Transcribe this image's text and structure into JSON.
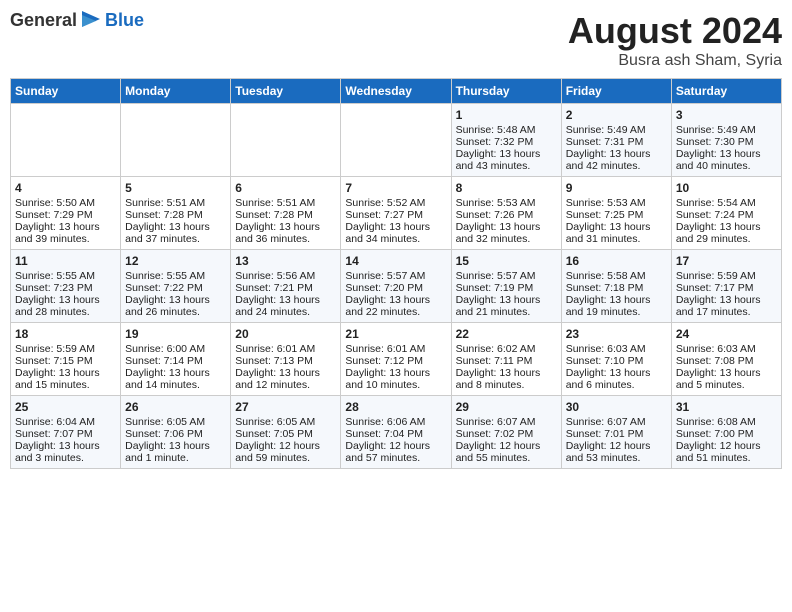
{
  "header": {
    "logo_general": "General",
    "logo_blue": "Blue",
    "title": "August 2024",
    "subtitle": "Busra ash Sham, Syria"
  },
  "calendar": {
    "columns": [
      "Sunday",
      "Monday",
      "Tuesday",
      "Wednesday",
      "Thursday",
      "Friday",
      "Saturday"
    ],
    "weeks": [
      [
        {
          "day": "",
          "content": ""
        },
        {
          "day": "",
          "content": ""
        },
        {
          "day": "",
          "content": ""
        },
        {
          "day": "",
          "content": ""
        },
        {
          "day": "1",
          "content": "Sunrise: 5:48 AM\nSunset: 7:32 PM\nDaylight: 13 hours\nand 43 minutes."
        },
        {
          "day": "2",
          "content": "Sunrise: 5:49 AM\nSunset: 7:31 PM\nDaylight: 13 hours\nand 42 minutes."
        },
        {
          "day": "3",
          "content": "Sunrise: 5:49 AM\nSunset: 7:30 PM\nDaylight: 13 hours\nand 40 minutes."
        }
      ],
      [
        {
          "day": "4",
          "content": "Sunrise: 5:50 AM\nSunset: 7:29 PM\nDaylight: 13 hours\nand 39 minutes."
        },
        {
          "day": "5",
          "content": "Sunrise: 5:51 AM\nSunset: 7:28 PM\nDaylight: 13 hours\nand 37 minutes."
        },
        {
          "day": "6",
          "content": "Sunrise: 5:51 AM\nSunset: 7:28 PM\nDaylight: 13 hours\nand 36 minutes."
        },
        {
          "day": "7",
          "content": "Sunrise: 5:52 AM\nSunset: 7:27 PM\nDaylight: 13 hours\nand 34 minutes."
        },
        {
          "day": "8",
          "content": "Sunrise: 5:53 AM\nSunset: 7:26 PM\nDaylight: 13 hours\nand 32 minutes."
        },
        {
          "day": "9",
          "content": "Sunrise: 5:53 AM\nSunset: 7:25 PM\nDaylight: 13 hours\nand 31 minutes."
        },
        {
          "day": "10",
          "content": "Sunrise: 5:54 AM\nSunset: 7:24 PM\nDaylight: 13 hours\nand 29 minutes."
        }
      ],
      [
        {
          "day": "11",
          "content": "Sunrise: 5:55 AM\nSunset: 7:23 PM\nDaylight: 13 hours\nand 28 minutes."
        },
        {
          "day": "12",
          "content": "Sunrise: 5:55 AM\nSunset: 7:22 PM\nDaylight: 13 hours\nand 26 minutes."
        },
        {
          "day": "13",
          "content": "Sunrise: 5:56 AM\nSunset: 7:21 PM\nDaylight: 13 hours\nand 24 minutes."
        },
        {
          "day": "14",
          "content": "Sunrise: 5:57 AM\nSunset: 7:20 PM\nDaylight: 13 hours\nand 22 minutes."
        },
        {
          "day": "15",
          "content": "Sunrise: 5:57 AM\nSunset: 7:19 PM\nDaylight: 13 hours\nand 21 minutes."
        },
        {
          "day": "16",
          "content": "Sunrise: 5:58 AM\nSunset: 7:18 PM\nDaylight: 13 hours\nand 19 minutes."
        },
        {
          "day": "17",
          "content": "Sunrise: 5:59 AM\nSunset: 7:17 PM\nDaylight: 13 hours\nand 17 minutes."
        }
      ],
      [
        {
          "day": "18",
          "content": "Sunrise: 5:59 AM\nSunset: 7:15 PM\nDaylight: 13 hours\nand 15 minutes."
        },
        {
          "day": "19",
          "content": "Sunrise: 6:00 AM\nSunset: 7:14 PM\nDaylight: 13 hours\nand 14 minutes."
        },
        {
          "day": "20",
          "content": "Sunrise: 6:01 AM\nSunset: 7:13 PM\nDaylight: 13 hours\nand 12 minutes."
        },
        {
          "day": "21",
          "content": "Sunrise: 6:01 AM\nSunset: 7:12 PM\nDaylight: 13 hours\nand 10 minutes."
        },
        {
          "day": "22",
          "content": "Sunrise: 6:02 AM\nSunset: 7:11 PM\nDaylight: 13 hours\nand 8 minutes."
        },
        {
          "day": "23",
          "content": "Sunrise: 6:03 AM\nSunset: 7:10 PM\nDaylight: 13 hours\nand 6 minutes."
        },
        {
          "day": "24",
          "content": "Sunrise: 6:03 AM\nSunset: 7:08 PM\nDaylight: 13 hours\nand 5 minutes."
        }
      ],
      [
        {
          "day": "25",
          "content": "Sunrise: 6:04 AM\nSunset: 7:07 PM\nDaylight: 13 hours\nand 3 minutes."
        },
        {
          "day": "26",
          "content": "Sunrise: 6:05 AM\nSunset: 7:06 PM\nDaylight: 13 hours\nand 1 minute."
        },
        {
          "day": "27",
          "content": "Sunrise: 6:05 AM\nSunset: 7:05 PM\nDaylight: 12 hours\nand 59 minutes."
        },
        {
          "day": "28",
          "content": "Sunrise: 6:06 AM\nSunset: 7:04 PM\nDaylight: 12 hours\nand 57 minutes."
        },
        {
          "day": "29",
          "content": "Sunrise: 6:07 AM\nSunset: 7:02 PM\nDaylight: 12 hours\nand 55 minutes."
        },
        {
          "day": "30",
          "content": "Sunrise: 6:07 AM\nSunset: 7:01 PM\nDaylight: 12 hours\nand 53 minutes."
        },
        {
          "day": "31",
          "content": "Sunrise: 6:08 AM\nSunset: 7:00 PM\nDaylight: 12 hours\nand 51 minutes."
        }
      ]
    ]
  }
}
